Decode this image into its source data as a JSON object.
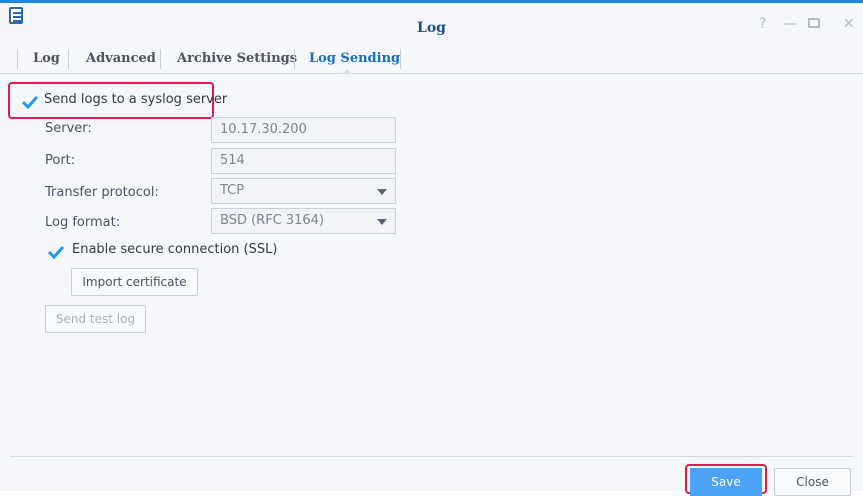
{
  "window": {
    "title": "Log",
    "accent_color": "#1e88e5",
    "controls": [
      {
        "name": "help-icon",
        "glyph": "?"
      },
      {
        "name": "minimize-icon",
        "glyph": "—"
      },
      {
        "name": "maximize-icon",
        "glyph": "▫"
      },
      {
        "name": "close-window-icon",
        "glyph": "✕"
      }
    ]
  },
  "tabs": [
    {
      "label": "Log",
      "active": false
    },
    {
      "label": "Advanced",
      "active": false
    },
    {
      "label": "Archive Settings",
      "active": false
    },
    {
      "label": "Log Sending",
      "active": true
    }
  ],
  "form": {
    "send_syslog": {
      "label": "Send logs to a syslog server",
      "checked": true
    },
    "server": {
      "label": "Server:",
      "value": "10.17.30.200"
    },
    "port": {
      "label": "Port:",
      "value": "514"
    },
    "protocol": {
      "label": "Transfer protocol:",
      "value": "TCP"
    },
    "format": {
      "label": "Log format:",
      "value": "BSD (RFC 3164)"
    },
    "ssl": {
      "label": "Enable secure connection (SSL)",
      "checked": true
    },
    "import_cert": "Import certificate",
    "send_test": "Send test log"
  },
  "footer": {
    "save": "Save",
    "close": "Close"
  },
  "colors": {
    "highlight": "#e0194e",
    "save": "#4aa3f7",
    "checkbox": "#2196f3"
  }
}
